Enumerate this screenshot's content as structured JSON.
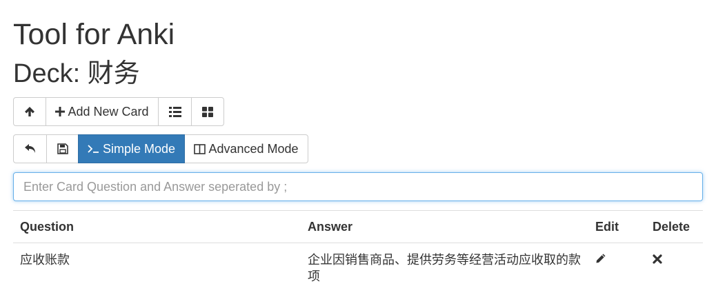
{
  "header": {
    "title": "Tool for Anki",
    "deck_label": "Deck: 财务"
  },
  "toolbar1": {
    "up_icon": "arrow-up-icon",
    "add_icon": "plus-icon",
    "add_label": "Add New Card",
    "list_icon": "list-icon",
    "grid_icon": "grid-icon"
  },
  "toolbar2": {
    "undo_icon": "undo-icon",
    "save_icon": "floppy-disk-icon",
    "simple_mode_label": "Simple Mode",
    "simple_mode_icon": "terminal-icon",
    "advanced_mode_label": "Advanced Mode",
    "advanced_mode_icon": "columns-icon",
    "active_mode": "simple"
  },
  "input": {
    "placeholder": "Enter Card Question and Answer seperated by ;",
    "value": ""
  },
  "table": {
    "headers": {
      "question": "Question",
      "answer": "Answer",
      "edit": "Edit",
      "delete": "Delete"
    },
    "rows": [
      {
        "question": "应收账款",
        "answer": "企业因销售商品、提供劳务等经营活动应收取的款项"
      }
    ]
  },
  "colors": {
    "primary": "#337ab7",
    "border": "#cccccc",
    "focus": "#66afe9",
    "text": "#333333"
  }
}
